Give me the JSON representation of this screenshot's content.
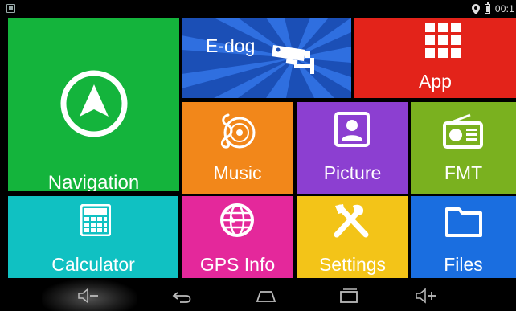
{
  "status_bar": {
    "clock": "00:1",
    "icons": [
      "notification-icon",
      "location-pin-icon",
      "battery-icon"
    ]
  },
  "tiles": {
    "navigation": {
      "label": "Navigation",
      "icon": "navigation-arrow-icon",
      "color": "#14b43c"
    },
    "edog": {
      "label": "E-dog",
      "icon": "speed-camera-icon",
      "color": "#1b4fb6"
    },
    "app": {
      "label": "App",
      "icon": "app-grid-icon",
      "color": "#e3231a"
    },
    "music": {
      "label": "Music",
      "icon": "music-disc-icon",
      "color": "#f2871a"
    },
    "picture": {
      "label": "Picture",
      "icon": "picture-icon",
      "color": "#8c3fd1"
    },
    "fmt": {
      "label": "FMT",
      "icon": "radio-icon",
      "color": "#7ab11f"
    },
    "calculator": {
      "label": "Calculator",
      "icon": "calculator-icon",
      "color": "#10c1c2"
    },
    "gps_info": {
      "label": "GPS Info",
      "icon": "globe-icon",
      "color": "#e4289b"
    },
    "settings": {
      "label": "Settings",
      "icon": "tools-icon",
      "color": "#f3c418"
    },
    "files": {
      "label": "Files",
      "icon": "folder-icon",
      "color": "#1a6ee0"
    }
  },
  "nav_bar": {
    "buttons": [
      "volume-down-icon",
      "back-icon",
      "home-icon",
      "recent-apps-icon",
      "volume-up-icon"
    ]
  }
}
